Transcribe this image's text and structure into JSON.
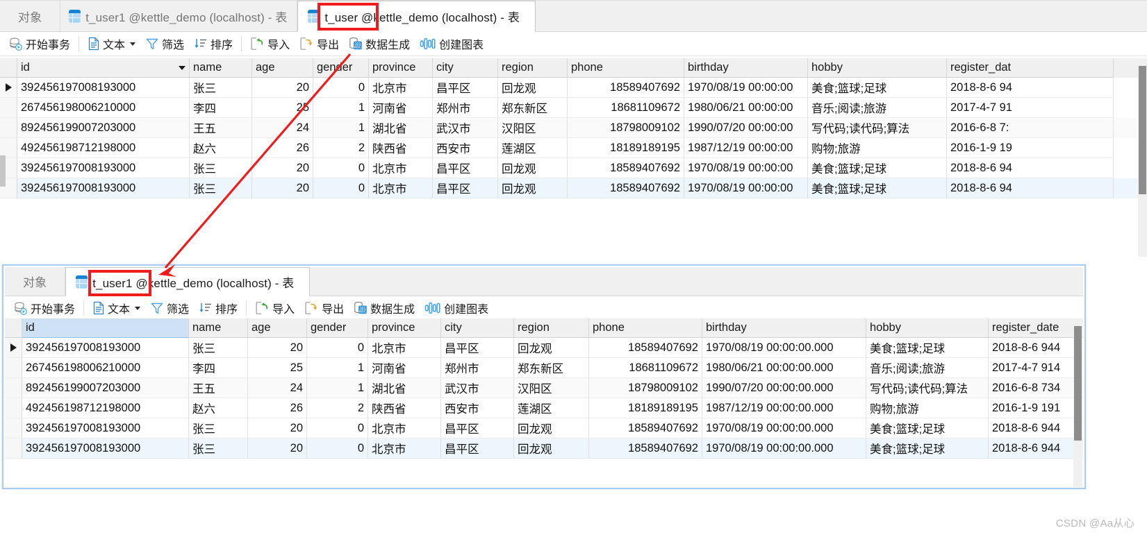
{
  "watermark": "CSDN @Aa从心",
  "top_window": {
    "tabs": [
      {
        "label": "对象",
        "icon": "none",
        "state": "objects"
      },
      {
        "label": "t_user1 @kettle_demo (localhost) - 表",
        "icon": "table-icon",
        "state": "inactive"
      },
      {
        "label": "t_user @kettle_demo (localhost) - 表",
        "icon": "table-icon",
        "state": "active"
      }
    ],
    "toolbar": [
      {
        "label": "开始事务",
        "icon": "begin-transaction-icon"
      },
      {
        "sep": true
      },
      {
        "label": "文本",
        "icon": "text-icon",
        "caret": true
      },
      {
        "label": "筛选",
        "icon": "filter-icon"
      },
      {
        "label": "排序",
        "icon": "sort-icon"
      },
      {
        "sep": true
      },
      {
        "label": "导入",
        "icon": "import-icon"
      },
      {
        "label": "导出",
        "icon": "export-icon"
      },
      {
        "label": "数据生成",
        "icon": "data-generation-icon"
      },
      {
        "label": "创建图表",
        "icon": "create-chart-icon"
      }
    ],
    "columns": [
      "id",
      "name",
      "age",
      "gender",
      "province",
      "city",
      "region",
      "phone",
      "birthday",
      "hobby",
      "register_dat"
    ],
    "selected_column": "id",
    "rows": [
      [
        "392456197008193000",
        "张三",
        "20",
        "0",
        "北京市",
        "昌平区",
        "回龙观",
        "18589407692",
        "1970/08/19 00:00:00",
        "美食;篮球;足球",
        "2018-8-6 94"
      ],
      [
        "267456198006210000",
        "李四",
        "25",
        "1",
        "河南省",
        "郑州市",
        "郑东新区",
        "18681109672",
        "1980/06/21 00:00:00",
        "音乐;阅读;旅游",
        "2017-4-7 91"
      ],
      [
        "892456199007203000",
        "王五",
        "24",
        "1",
        "湖北省",
        "武汉市",
        "汉阳区",
        "18798009102",
        "1990/07/20 00:00:00",
        "写代码;读代码;算法",
        "2016-6-8 7:"
      ],
      [
        "492456198712198000",
        "赵六",
        "26",
        "2",
        "陕西省",
        "西安市",
        "莲湖区",
        "18189189195",
        "1987/12/19 00:00:00",
        "购物;旅游",
        "2016-1-9 19"
      ],
      [
        "392456197008193000",
        "张三",
        "20",
        "0",
        "北京市",
        "昌平区",
        "回龙观",
        "18589407692",
        "1970/08/19 00:00:00",
        "美食;篮球;足球",
        "2018-8-6 94"
      ],
      [
        "392456197008193000",
        "张三",
        "20",
        "0",
        "北京市",
        "昌平区",
        "回龙观",
        "18589407692",
        "1970/08/19 00:00:00",
        "美食;篮球;足球",
        "2018-8-6 94"
      ]
    ],
    "current_row_index": 0,
    "selected_row_index": 5
  },
  "bottom_window": {
    "tabs": [
      {
        "label": "对象",
        "icon": "none",
        "state": "objects"
      },
      {
        "label": "t_user1 @kettle_demo (localhost) - 表",
        "icon": "table-icon",
        "state": "active"
      }
    ],
    "toolbar": [
      {
        "label": "开始事务",
        "icon": "begin-transaction-icon"
      },
      {
        "sep": true
      },
      {
        "label": "文本",
        "icon": "text-icon",
        "caret": true
      },
      {
        "label": "筛选",
        "icon": "filter-icon"
      },
      {
        "label": "排序",
        "icon": "sort-icon"
      },
      {
        "sep": true
      },
      {
        "label": "导入",
        "icon": "import-icon"
      },
      {
        "label": "导出",
        "icon": "export-icon"
      },
      {
        "label": "数据生成",
        "icon": "data-generation-icon"
      },
      {
        "label": "创建图表",
        "icon": "create-chart-icon"
      }
    ],
    "columns": [
      "id",
      "name",
      "age",
      "gender",
      "province",
      "city",
      "region",
      "phone",
      "birthday",
      "hobby",
      "register_date"
    ],
    "selected_column": "id",
    "rows": [
      [
        "392456197008193000",
        "张三",
        "20",
        "0",
        "北京市",
        "昌平区",
        "回龙观",
        "18589407692",
        "1970/08/19 00:00:00.000",
        "美食;篮球;足球",
        "2018-8-6 944"
      ],
      [
        "267456198006210000",
        "李四",
        "25",
        "1",
        "河南省",
        "郑州市",
        "郑东新区",
        "18681109672",
        "1980/06/21 00:00:00.000",
        "音乐;阅读;旅游",
        "2017-4-7 914"
      ],
      [
        "892456199007203000",
        "王五",
        "24",
        "1",
        "湖北省",
        "武汉市",
        "汉阳区",
        "18798009102",
        "1990/07/20 00:00:00.000",
        "写代码;读代码;算法",
        "2016-6-8 734"
      ],
      [
        "492456198712198000",
        "赵六",
        "26",
        "2",
        "陕西省",
        "西安市",
        "莲湖区",
        "18189189195",
        "1987/12/19 00:00:00.000",
        "购物;旅游",
        "2016-1-9 191"
      ],
      [
        "392456197008193000",
        "张三",
        "20",
        "0",
        "北京市",
        "昌平区",
        "回龙观",
        "18589407692",
        "1970/08/19 00:00:00.000",
        "美食;篮球;足球",
        "2018-8-6 944"
      ],
      [
        "392456197008193000",
        "张三",
        "20",
        "0",
        "北京市",
        "昌平区",
        "回龙观",
        "18589407692",
        "1970/08/19 00:00:00.000",
        "美食;篮球;足球",
        "2018-8-6 944"
      ]
    ],
    "current_row_index": 0,
    "selected_row_index": 5
  },
  "annotations": {
    "highlight_color": "#ee1c1c",
    "boxes": [
      {
        "name": "top-tab-highlight",
        "target": "t_user"
      },
      {
        "name": "bottom-tab-highlight",
        "target": "t_user1"
      }
    ],
    "arrow": {
      "name": "export-to-tab-arrow",
      "from": "导出",
      "to": "t_user1"
    }
  }
}
